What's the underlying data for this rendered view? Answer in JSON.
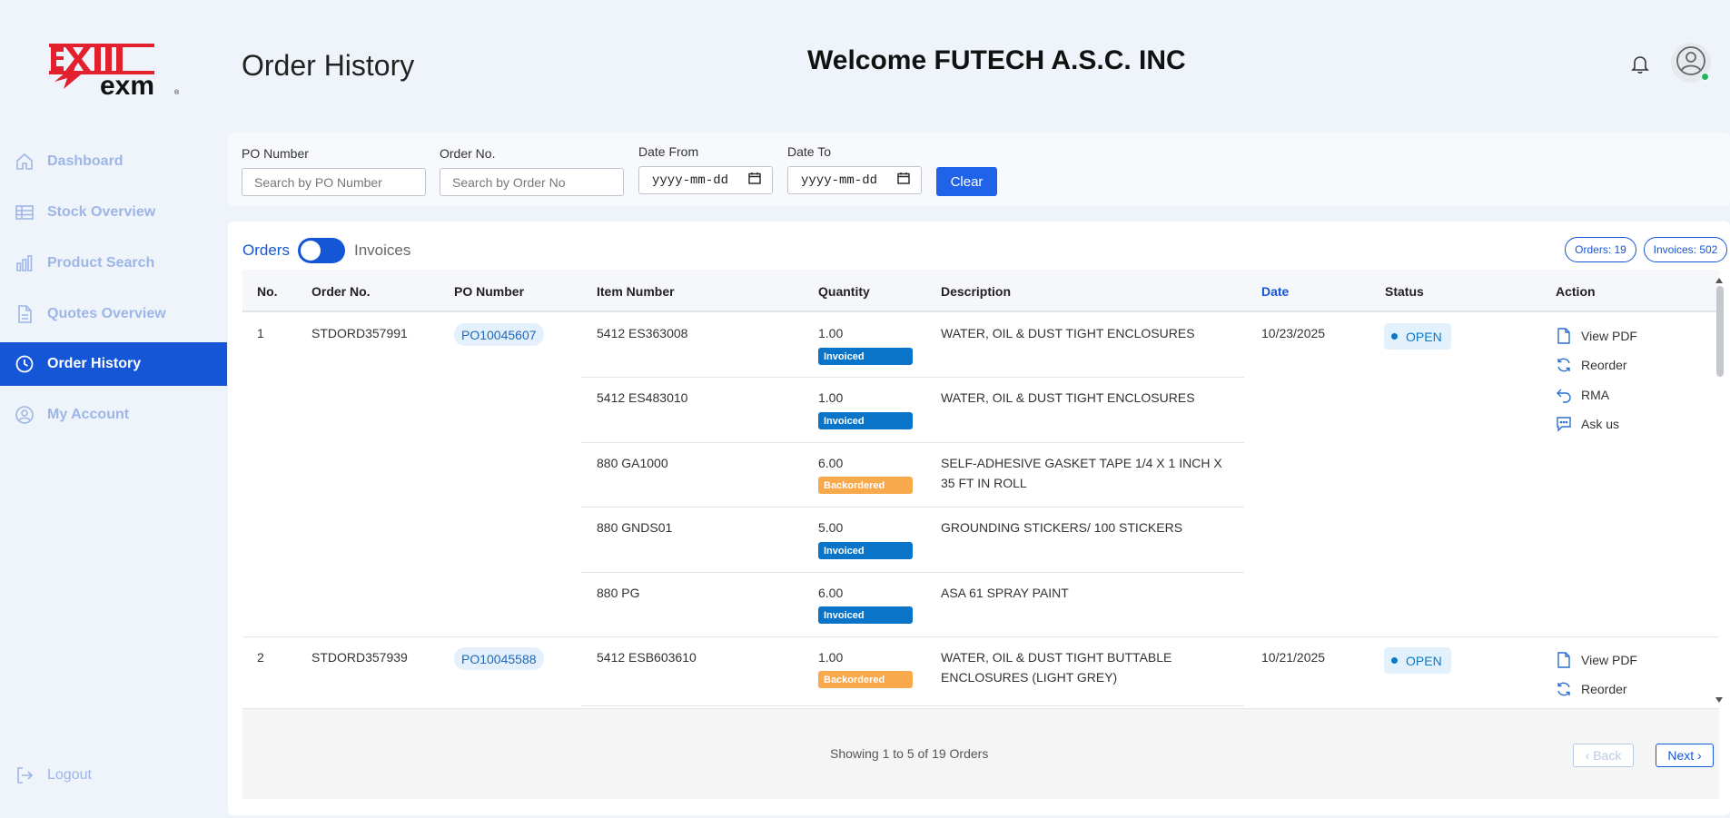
{
  "brand": {
    "logo_text_top": "EXIII",
    "logo_text_bottom": "exm",
    "colors": {
      "red": "#e3202e",
      "accent": "#1556d7"
    }
  },
  "header": {
    "title": "Order History",
    "welcome": "Welcome FUTECH A.S.C. INC"
  },
  "sidebar": {
    "items": [
      {
        "label": "Dashboard",
        "icon": "home-icon"
      },
      {
        "label": "Stock Overview",
        "icon": "table-icon"
      },
      {
        "label": "Product Search",
        "icon": "bar-chart-icon"
      },
      {
        "label": "Quotes Overview",
        "icon": "document-icon"
      },
      {
        "label": "Order History",
        "icon": "clock-icon",
        "active": true
      },
      {
        "label": "My Account",
        "icon": "user-circle-icon"
      }
    ],
    "logout": "Logout"
  },
  "filters": {
    "po_label": "PO Number",
    "po_placeholder": "Search by PO Number",
    "order_label": "Order No.",
    "order_placeholder": "Search by Order No",
    "date_from_label": "Date From",
    "date_from_value": "yyyy-mm-dd",
    "date_to_label": "Date To",
    "date_to_value": "yyyy-mm-dd",
    "clear_label": "Clear"
  },
  "view_toggle": {
    "orders_label": "Orders",
    "invoices_label": "Invoices",
    "orders_count": "Orders: 19",
    "invoices_count": "Invoices: 502"
  },
  "table": {
    "columns": [
      "No.",
      "Order No.",
      "PO Number",
      "Item Number",
      "Quantity",
      "Description",
      "Date",
      "Status",
      "Action"
    ],
    "orders": [
      {
        "no": "1",
        "order_no": "STDORD357991",
        "po": "PO10045607",
        "date": "10/23/2025",
        "status": "OPEN",
        "actions": [
          "View PDF",
          "Reorder",
          "RMA",
          "Ask us"
        ],
        "lines": [
          {
            "item": "5412 ES363008",
            "qty": "1.00",
            "badge": "Invoiced",
            "desc": "WATER, OIL & DUST TIGHT ENCLOSURES"
          },
          {
            "item": "5412 ES483010",
            "qty": "1.00",
            "badge": "Invoiced",
            "desc": "WATER, OIL & DUST TIGHT ENCLOSURES"
          },
          {
            "item": "880 GA1000",
            "qty": "6.00",
            "badge": "Backordered",
            "desc": "SELF-ADHESIVE GASKET TAPE 1/4 X 1 INCH X",
            "desc2": "35 FT IN ROLL"
          },
          {
            "item": "880 GNDS01",
            "qty": "5.00",
            "badge": "Invoiced",
            "desc": "GROUNDING STICKERS/ 100 STICKERS"
          },
          {
            "item": "880 PG",
            "qty": "6.00",
            "badge": "Invoiced",
            "desc": "ASA 61 SPRAY PAINT"
          }
        ]
      },
      {
        "no": "2",
        "order_no": "STDORD357939",
        "po": "PO10045588",
        "date": "10/21/2025",
        "status": "OPEN",
        "actions": [
          "View PDF",
          "Reorder"
        ],
        "lines": [
          {
            "item": "5412 ESB603610",
            "qty": "1.00",
            "badge": "Backordered",
            "desc": "WATER, OIL & DUST TIGHT BUTTABLE",
            "desc2": "ENCLOSURES (LIGHT GREY)"
          }
        ]
      }
    ]
  },
  "pagination": {
    "showing": "Showing 1 to 5 of 19 Orders",
    "back": "‹ Back",
    "next": "Next ›"
  }
}
